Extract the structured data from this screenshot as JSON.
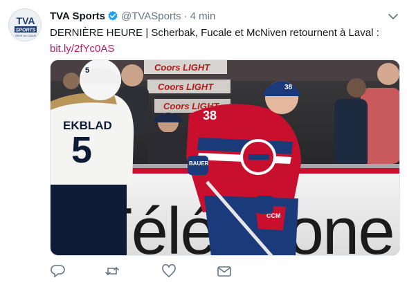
{
  "author": {
    "name": "TVA Sports",
    "handle": "@TVASports",
    "separator": "·",
    "time": "4 min",
    "avatar_text_top": "TVA",
    "avatar_text_mid": "SPORTS",
    "avatar_text_bottom": "DROIT AU COEUR"
  },
  "tweet": {
    "text": "DERNIÈRE HEURE | Scherbak, Fucale et McNiven retournent à Laval :",
    "link": "bit.ly/2fYc0AS"
  },
  "image": {
    "boards_text": "Téléphone",
    "ad_text_1": "Coors LIGHT",
    "ad_text_2": "Coors LIGHT",
    "ad_text_3": "Coors LIGHT",
    "player_left_name": "EKBLAD",
    "player_left_number": "5",
    "player_left_helmet_number": "5",
    "player_right_number": "38",
    "player_right_helmet_number": "38",
    "glove_brand": "BAUER",
    "pants_brand": "CCM"
  },
  "actions": [
    "reply-icon",
    "retweet-icon",
    "like-icon",
    "message-icon"
  ],
  "colors": {
    "link": "#c2175b",
    "verified": "#1da1f2",
    "icon": "#657786",
    "canadiens_red": "#c8102e",
    "canadiens_blue": "#1b3a7a"
  }
}
